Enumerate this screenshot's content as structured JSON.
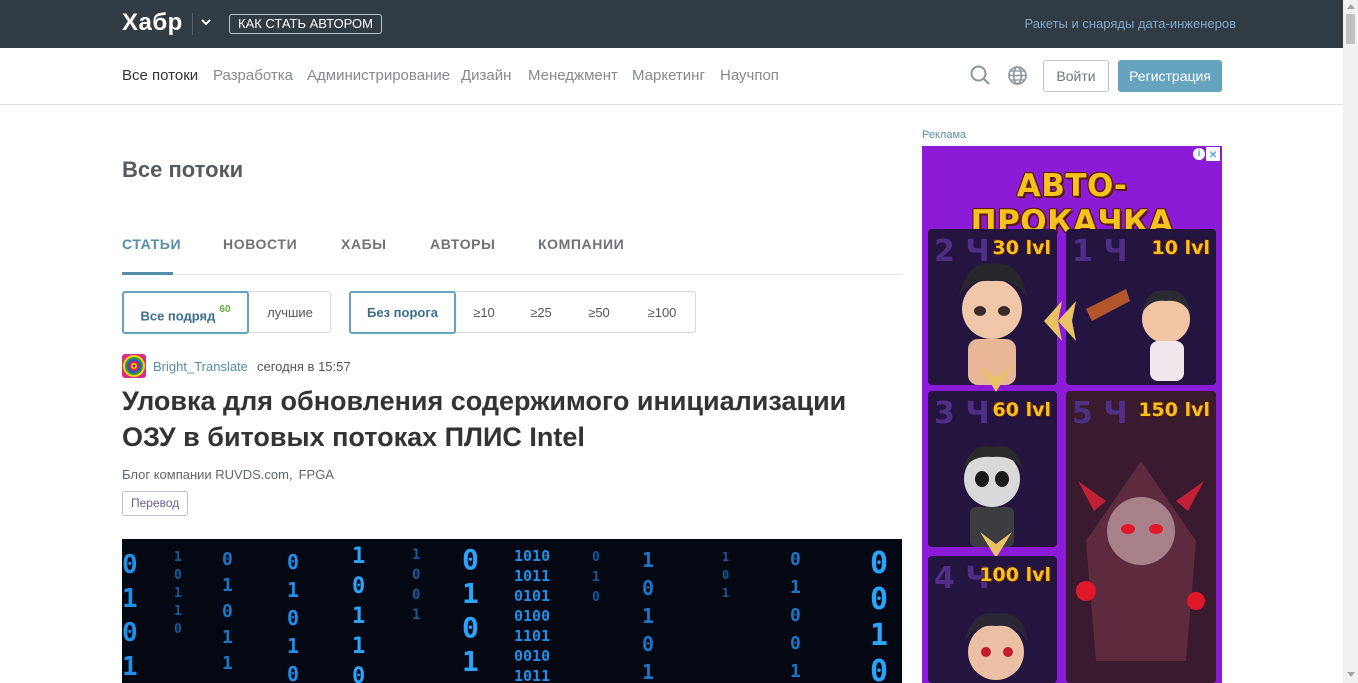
{
  "header": {
    "logo": "Хабр",
    "become_author": "КАК СТАТЬ АВТОРОМ",
    "promo_link": "Ракеты и снаряды дата-инженеров"
  },
  "nav": {
    "items": [
      "Все потоки",
      "Разработка",
      "Администрирование",
      "Дизайн",
      "Менеджмент",
      "Маркетинг",
      "Научпоп"
    ],
    "active_index": 0,
    "login": "Войти",
    "register": "Регистрация"
  },
  "main": {
    "title": "Все потоки",
    "tabs": [
      "СТАТЬИ",
      "НОВОСТИ",
      "ХАБЫ",
      "АВТОРЫ",
      "КОМПАНИИ"
    ],
    "active_tab": 0,
    "filters_sort": {
      "all": "Все подряд",
      "all_count": "60",
      "best": "лучшие"
    },
    "filters_rating": [
      "Без порога",
      "≥10",
      "≥25",
      "≥50",
      "≥100"
    ]
  },
  "post": {
    "author": "Bright_Translate",
    "time": "сегодня в 15:57",
    "title": "Уловка для обновления содержимого инициализации ОЗУ в битовых потоках ПЛИС Intel",
    "hubs": [
      "Блог компании RUVDS.com,",
      "FPGA"
    ],
    "badge": "Перевод"
  },
  "ad": {
    "label": "Реклама",
    "headline": "АВТО-ПРОКАЧКА",
    "cards": [
      {
        "hours": "2 Ч",
        "level": "30 lvl"
      },
      {
        "hours": "1 Ч",
        "level": "10 lvl"
      },
      {
        "hours": "3 Ч",
        "level": "60 lvl"
      },
      {
        "hours": "5 Ч",
        "level": "150 lvl"
      },
      {
        "hours": "4 Ч",
        "level": "100 lvl"
      }
    ]
  },
  "colors": {
    "header_bg": "#303b44",
    "accent": "#548eaa",
    "register_bg": "#65a3be",
    "ad_bg": "#8b1bd6",
    "ad_gold": "#f7c21e"
  }
}
